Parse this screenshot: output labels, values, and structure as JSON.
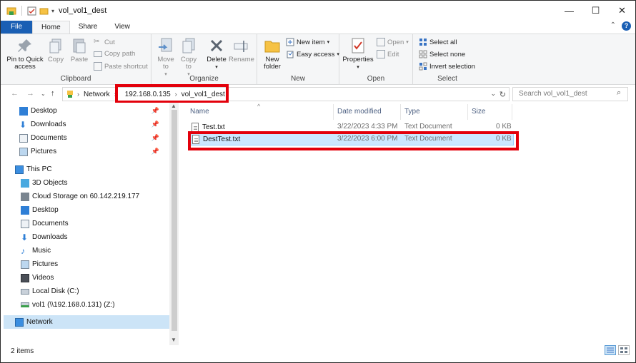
{
  "window": {
    "title": "vol_vol1_dest",
    "minimize": "—",
    "maximize": "☐",
    "close": "✕"
  },
  "tabs": [
    "File",
    "Home",
    "Share",
    "View"
  ],
  "ribbon": {
    "clipboard": {
      "label": "Clipboard",
      "pin": "Pin to Quick access",
      "copy": "Copy",
      "paste": "Paste",
      "cut": "Cut",
      "copy_path": "Copy path",
      "paste_shortcut": "Paste shortcut"
    },
    "organize": {
      "label": "Organize",
      "move_to": "Move to",
      "copy_to": "Copy to",
      "delete": "Delete",
      "rename": "Rename"
    },
    "new": {
      "label": "New",
      "new_folder": "New folder",
      "new_item": "New item",
      "easy_access": "Easy access"
    },
    "open": {
      "label": "Open",
      "properties": "Properties",
      "open": "Open",
      "edit": "Edit"
    },
    "select": {
      "label": "Select",
      "select_all": "Select all",
      "select_none": "Select none",
      "invert": "Invert selection"
    }
  },
  "address": {
    "root": "Network",
    "crumbs": [
      "192.168.0.135",
      "vol_vol1_dest"
    ],
    "search_placeholder": "Search vol_vol1_dest"
  },
  "nav": {
    "quick_access": [
      {
        "label": "Desktop",
        "icon": "desktop-icon"
      },
      {
        "label": "Downloads",
        "icon": "downloads-icon"
      },
      {
        "label": "Documents",
        "icon": "documents-icon"
      },
      {
        "label": "Pictures",
        "icon": "pictures-icon"
      }
    ],
    "this_pc": "This PC",
    "pc_items": [
      {
        "label": "3D Objects",
        "icon": "3d-objects-icon"
      },
      {
        "label": "Cloud Storage on 60.142.219.177",
        "icon": "cloud-storage-icon"
      },
      {
        "label": "Desktop",
        "icon": "desktop-icon"
      },
      {
        "label": "Documents",
        "icon": "documents-icon"
      },
      {
        "label": "Downloads",
        "icon": "downloads-icon"
      },
      {
        "label": "Music",
        "icon": "music-icon"
      },
      {
        "label": "Pictures",
        "icon": "pictures-icon"
      },
      {
        "label": "Videos",
        "icon": "videos-icon"
      },
      {
        "label": "Local Disk (C:)",
        "icon": "local-disk-icon"
      },
      {
        "label": "vol1 (\\\\192.168.0.131) (Z:)",
        "icon": "network-drive-icon"
      }
    ],
    "network": "Network"
  },
  "columns": {
    "name": "Name",
    "date": "Date modified",
    "type": "Type",
    "size": "Size"
  },
  "files": [
    {
      "name": "Test.txt",
      "date": "3/22/2023 4:33 PM",
      "type": "Text Document",
      "size": "0 KB",
      "selected": false
    },
    {
      "name": "DestTest.txt",
      "date": "3/22/2023 6:00 PM",
      "type": "Text Document",
      "size": "0 KB",
      "selected": true
    }
  ],
  "status": {
    "count": "2 items"
  },
  "colors": {
    "file_tab": "#1a5fb4",
    "highlight_box": "#e3000b",
    "selection": "#cce8ff"
  }
}
